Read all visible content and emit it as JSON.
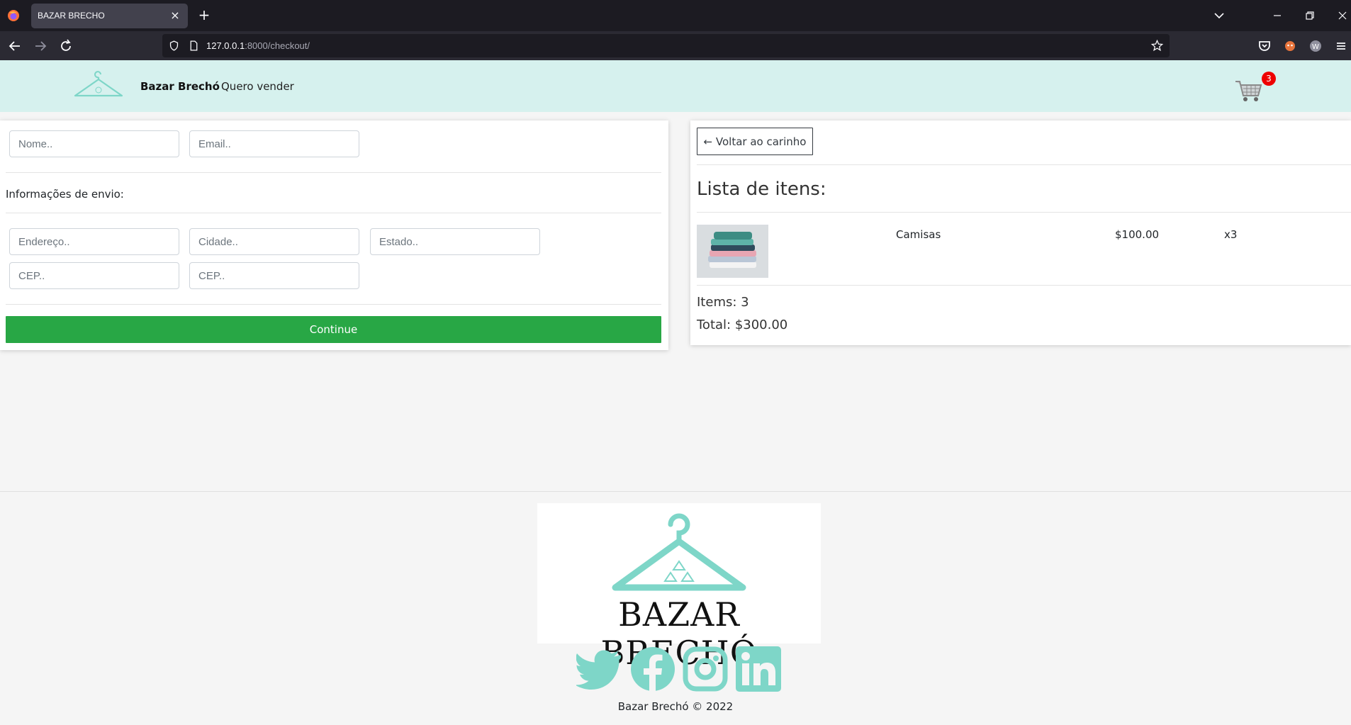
{
  "browser": {
    "tab_title": "BAZAR BRECHO",
    "tab_close": "×",
    "new_tab": "+",
    "url_host": "127.0.0.1",
    "url_path": ":8000/checkout/",
    "icons": [
      "firefox-icon",
      "back-icon",
      "forward-icon",
      "reload-icon",
      "shield-icon",
      "page-icon",
      "star-icon",
      "pocket-icon",
      "extension-icon",
      "account-icon",
      "menu-icon",
      "tabs-list-icon",
      "minimize-icon",
      "restore-icon",
      "close-window-icon"
    ]
  },
  "header": {
    "brand": "Bazar Brechó",
    "sell_link": "Quero vender",
    "cart_count": "3",
    "accent_color": "#d6f1ee"
  },
  "form": {
    "name_placeholder": "Nome..",
    "email_placeholder": "Email..",
    "shipping_title": "Informações de envio:",
    "address_placeholder": "Endereço..",
    "city_placeholder": "Cidade..",
    "state_placeholder": "Estado..",
    "zip_placeholder": "CEP..",
    "zip2_placeholder": "CEP..",
    "continue_label": "Continue",
    "continue_color": "#28a745"
  },
  "summary": {
    "back_label": "← Voltar ao carinho",
    "title": "Lista de itens:",
    "items": [
      {
        "name": "Camisas",
        "price": "$100.00",
        "qty": "x3"
      }
    ],
    "items_line": "Items: 3",
    "total_line": "Total: $300.00"
  },
  "footer": {
    "logo_text": "BAZAR BRECHÓ",
    "socials": [
      "twitter-icon",
      "facebook-icon",
      "instagram-icon",
      "linkedin-icon"
    ],
    "social_color": "#7ed6c8",
    "copyright": "Bazar Brechó © 2022"
  }
}
